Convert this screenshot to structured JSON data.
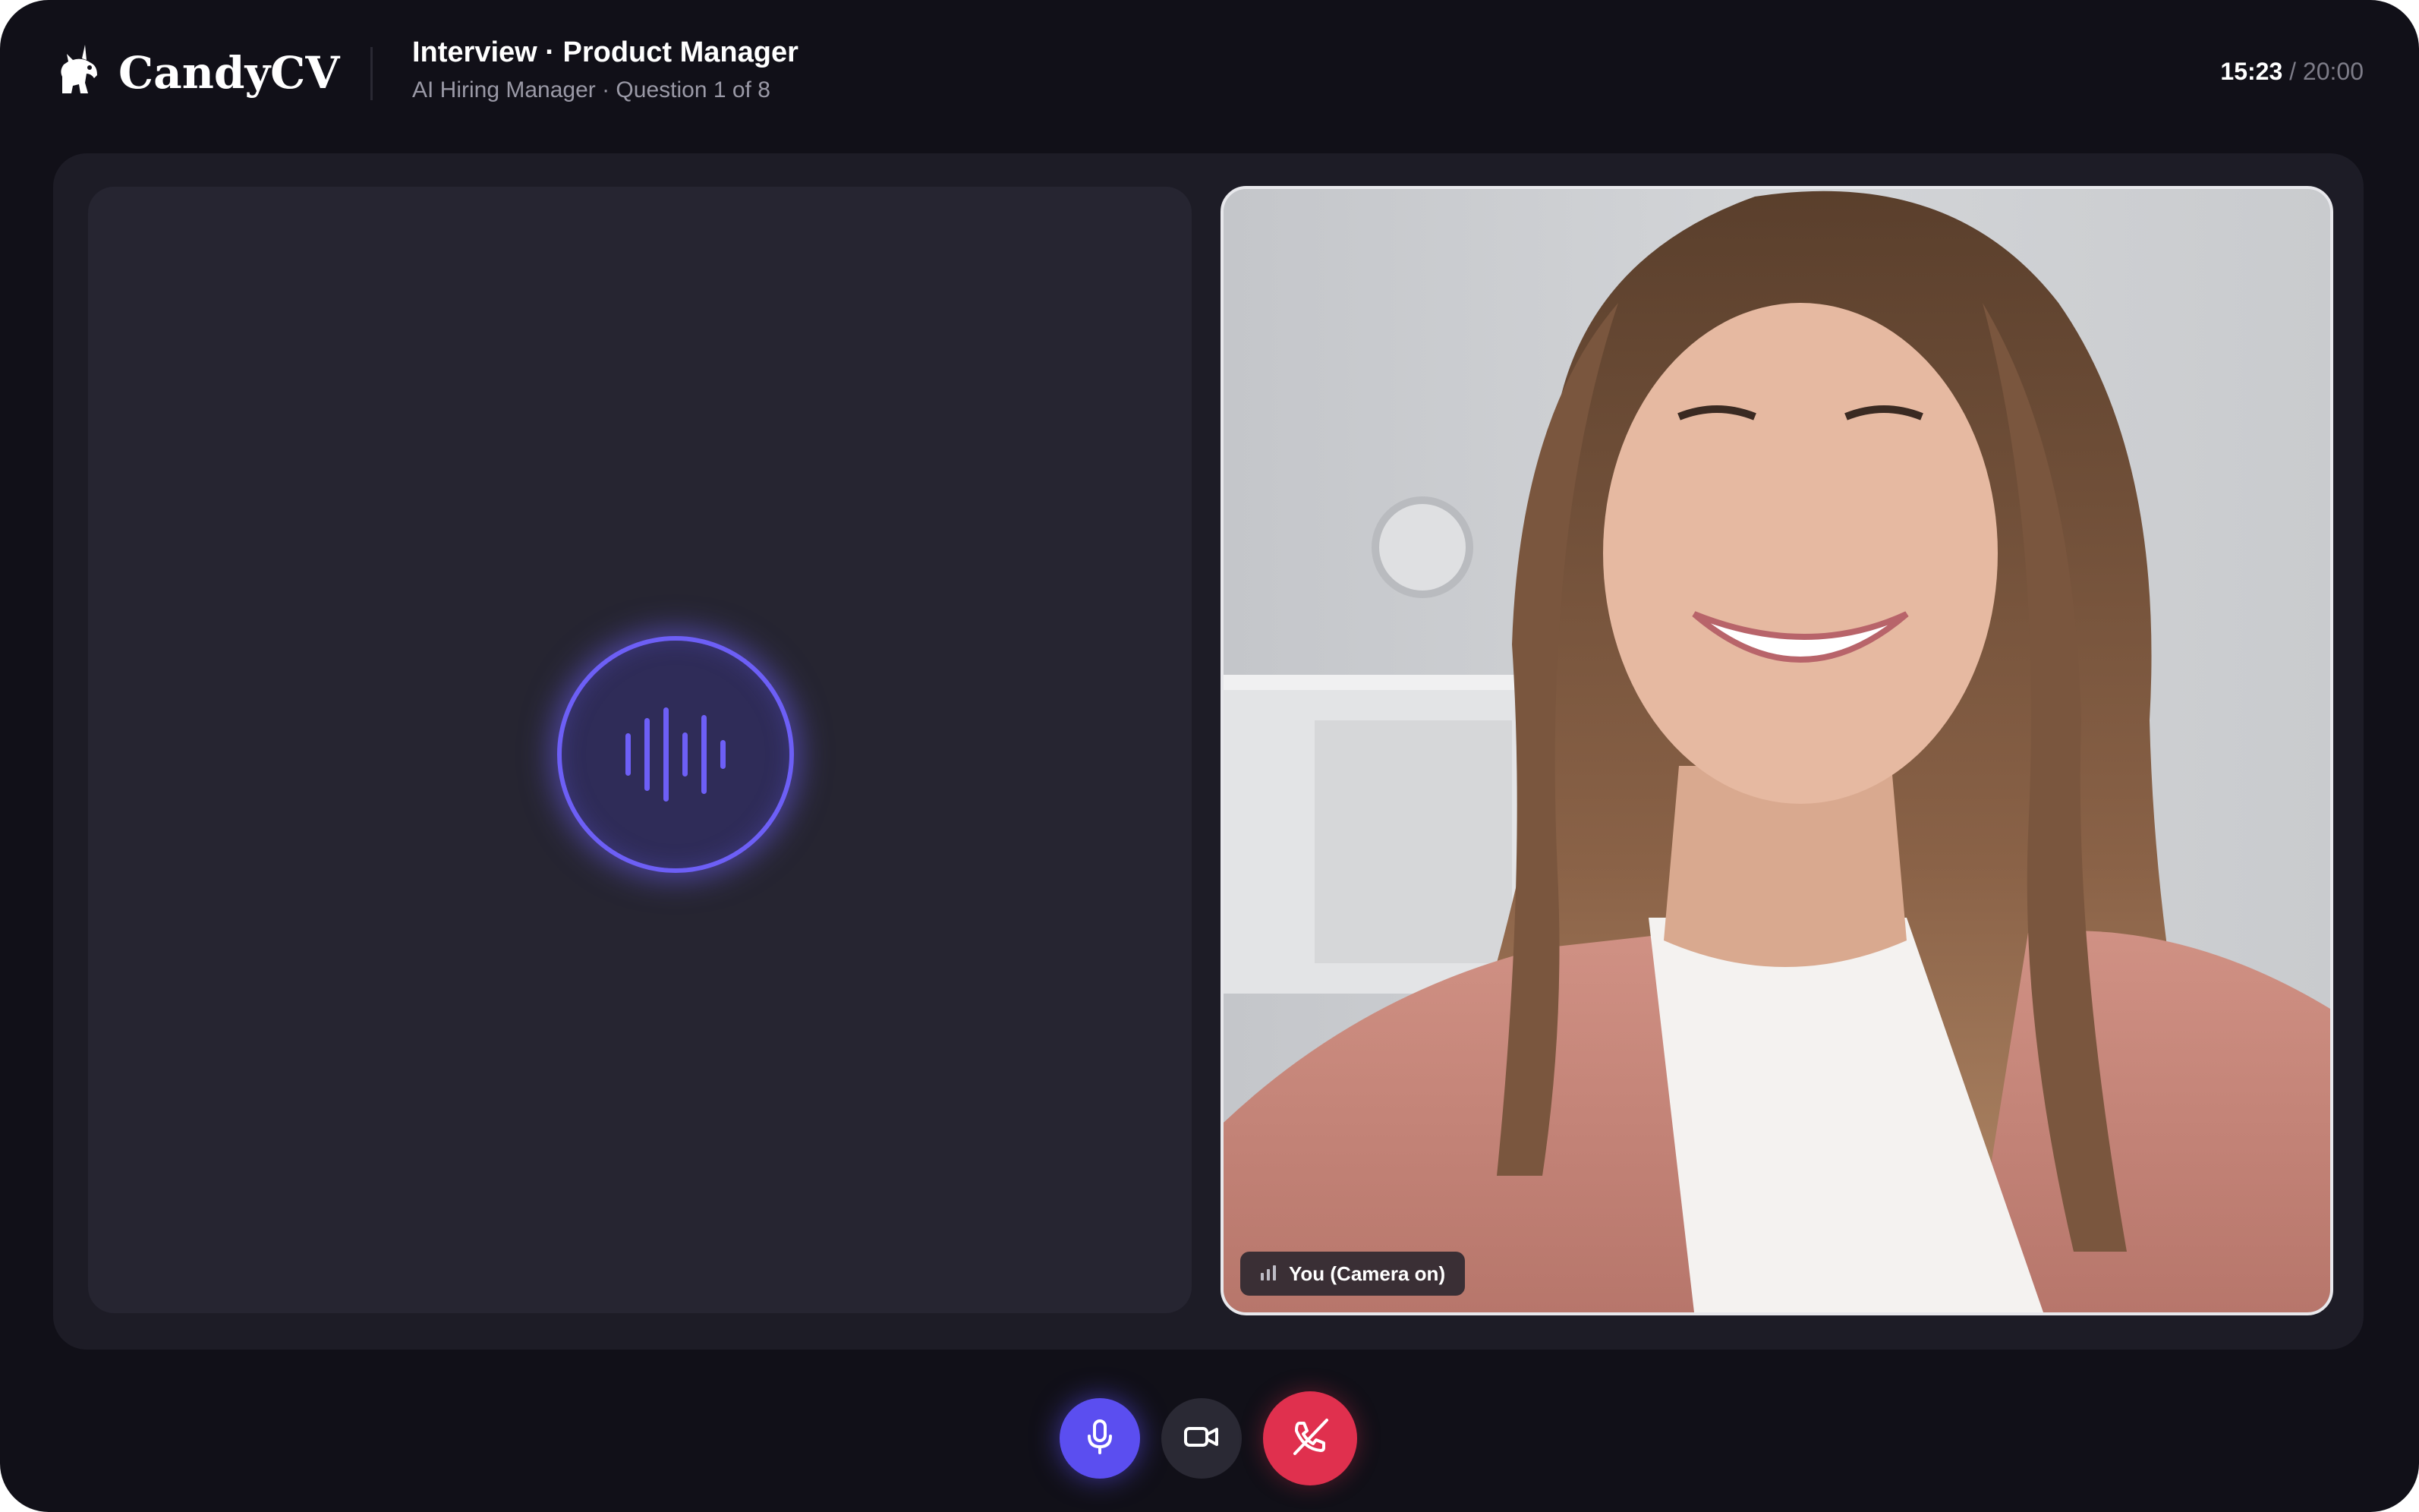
{
  "brand": {
    "name": "CandyCV",
    "logo_icon": "unicorn-icon"
  },
  "header": {
    "title": "Interview · Product Manager",
    "subtitle": "AI Hiring Manager · Question 1 of 8"
  },
  "timer": {
    "elapsed": "15:23",
    "separator": " / ",
    "total": "20:00"
  },
  "ai_panel": {
    "icon": "audio-waveform-icon",
    "accent_color": "#6d5ff6"
  },
  "video_panel": {
    "label": "You (Camera on)",
    "label_icon": "signal-bars-icon"
  },
  "controls": {
    "mic": {
      "icon": "microphone-icon",
      "color": "#5b4ef0"
    },
    "camera": {
      "icon": "video-camera-icon",
      "color": "#2a2934"
    },
    "end_call": {
      "icon": "phone-hangup-icon",
      "color": "#e0304e"
    }
  }
}
